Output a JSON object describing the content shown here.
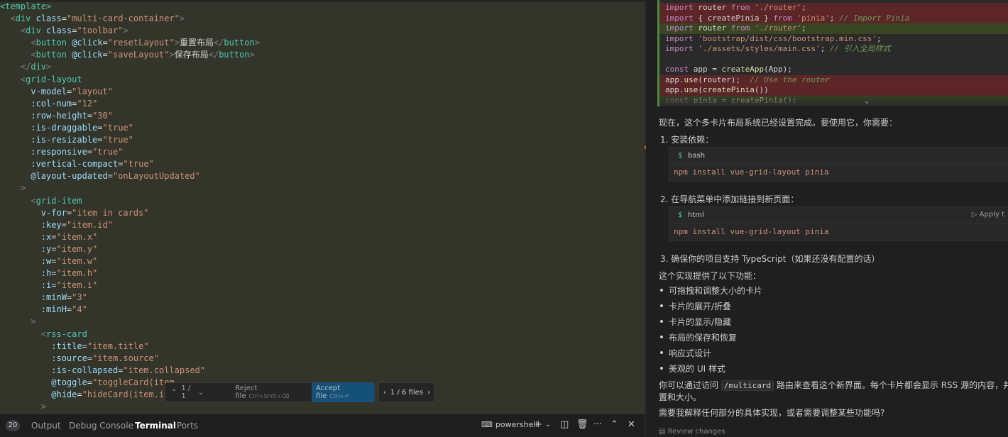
{
  "editor": {
    "lines": [
      [
        [
          "tag",
          "<template>"
        ]
      ],
      [
        [
          "tx",
          "  "
        ],
        [
          "br",
          "<"
        ],
        [
          "tag",
          "div"
        ],
        [
          "tx",
          " "
        ],
        [
          "at",
          "class"
        ],
        [
          "tx",
          "="
        ],
        [
          "st",
          "\"multi-card-container\""
        ],
        [
          "br",
          ">"
        ]
      ],
      [
        [
          "tx",
          "    "
        ],
        [
          "br",
          "<"
        ],
        [
          "tag",
          "div"
        ],
        [
          "tx",
          " "
        ],
        [
          "at",
          "class"
        ],
        [
          "tx",
          "="
        ],
        [
          "st",
          "\"toolbar\""
        ],
        [
          "br",
          ">"
        ]
      ],
      [
        [
          "tx",
          "      "
        ],
        [
          "br",
          "<"
        ],
        [
          "tag",
          "button"
        ],
        [
          "tx",
          " "
        ],
        [
          "at",
          "@click"
        ],
        [
          "tx",
          "="
        ],
        [
          "st",
          "\"resetLayout\""
        ],
        [
          "br",
          ">"
        ],
        [
          "tx",
          "重置布局"
        ],
        [
          "br",
          "</"
        ],
        [
          "tag",
          "button"
        ],
        [
          "br",
          ">"
        ]
      ],
      [
        [
          "tx",
          "      "
        ],
        [
          "br",
          "<"
        ],
        [
          "tag",
          "button"
        ],
        [
          "tx",
          " "
        ],
        [
          "at",
          "@click"
        ],
        [
          "tx",
          "="
        ],
        [
          "st",
          "\"saveLayout\""
        ],
        [
          "br",
          ">"
        ],
        [
          "tx",
          "保存布局"
        ],
        [
          "br",
          "</"
        ],
        [
          "tag",
          "button"
        ],
        [
          "br",
          ">"
        ]
      ],
      [
        [
          "tx",
          "    "
        ],
        [
          "br",
          "</"
        ],
        [
          "tag",
          "div"
        ],
        [
          "br",
          ">"
        ]
      ],
      [
        [
          "tx",
          "    "
        ],
        [
          "br",
          "<"
        ],
        [
          "tag",
          "grid-layout"
        ]
      ],
      [
        [
          "tx",
          "      "
        ],
        [
          "at",
          "v-model"
        ],
        [
          "tx",
          "="
        ],
        [
          "st",
          "\"layout\""
        ]
      ],
      [
        [
          "tx",
          "      "
        ],
        [
          "at",
          ":col-num"
        ],
        [
          "tx",
          "="
        ],
        [
          "st",
          "\"12\""
        ]
      ],
      [
        [
          "tx",
          "      "
        ],
        [
          "at",
          ":row-height"
        ],
        [
          "tx",
          "="
        ],
        [
          "st",
          "\"30\""
        ]
      ],
      [
        [
          "tx",
          "      "
        ],
        [
          "at",
          ":is-draggable"
        ],
        [
          "tx",
          "="
        ],
        [
          "st",
          "\"true\""
        ]
      ],
      [
        [
          "tx",
          "      "
        ],
        [
          "at",
          ":is-resizable"
        ],
        [
          "tx",
          "="
        ],
        [
          "st",
          "\"true\""
        ]
      ],
      [
        [
          "tx",
          "      "
        ],
        [
          "at",
          ":responsive"
        ],
        [
          "tx",
          "="
        ],
        [
          "st",
          "\"true\""
        ]
      ],
      [
        [
          "tx",
          "      "
        ],
        [
          "at",
          ":vertical-compact"
        ],
        [
          "tx",
          "="
        ],
        [
          "st",
          "\"true\""
        ]
      ],
      [
        [
          "tx",
          "      "
        ],
        [
          "at",
          "@layout-updated"
        ],
        [
          "tx",
          "="
        ],
        [
          "st",
          "\"onLayoutUpdated\""
        ]
      ],
      [
        [
          "tx",
          "    "
        ],
        [
          "br",
          ">"
        ]
      ],
      [
        [
          "tx",
          "      "
        ],
        [
          "br",
          "<"
        ],
        [
          "tag",
          "grid-item"
        ]
      ],
      [
        [
          "tx",
          "        "
        ],
        [
          "at",
          "v-for"
        ],
        [
          "tx",
          "="
        ],
        [
          "st",
          "\"item in cards\""
        ]
      ],
      [
        [
          "tx",
          "        "
        ],
        [
          "at",
          ":key"
        ],
        [
          "tx",
          "="
        ],
        [
          "st",
          "\"item.id\""
        ]
      ],
      [
        [
          "tx",
          "        "
        ],
        [
          "at",
          ":x"
        ],
        [
          "tx",
          "="
        ],
        [
          "st",
          "\"item.x\""
        ]
      ],
      [
        [
          "tx",
          "        "
        ],
        [
          "at",
          ":y"
        ],
        [
          "tx",
          "="
        ],
        [
          "st",
          "\"item.y\""
        ]
      ],
      [
        [
          "tx",
          "        "
        ],
        [
          "at",
          ":w"
        ],
        [
          "tx",
          "="
        ],
        [
          "st",
          "\"item.w\""
        ]
      ],
      [
        [
          "tx",
          "        "
        ],
        [
          "at",
          ":h"
        ],
        [
          "tx",
          "="
        ],
        [
          "st",
          "\"item.h\""
        ]
      ],
      [
        [
          "tx",
          "        "
        ],
        [
          "at",
          ":i"
        ],
        [
          "tx",
          "="
        ],
        [
          "st",
          "\"item.i\""
        ]
      ],
      [
        [
          "tx",
          "        "
        ],
        [
          "at",
          ":minW"
        ],
        [
          "tx",
          "="
        ],
        [
          "st",
          "\"3\""
        ]
      ],
      [
        [
          "tx",
          "        "
        ],
        [
          "at",
          ":minH"
        ],
        [
          "tx",
          "="
        ],
        [
          "st",
          "\"4\""
        ]
      ],
      [
        [
          "tx",
          "      "
        ],
        [
          "br",
          ">"
        ]
      ],
      [
        [
          "tx",
          "        "
        ],
        [
          "br",
          "<"
        ],
        [
          "tag",
          "rss-card"
        ]
      ],
      [
        [
          "tx",
          "          "
        ],
        [
          "at",
          ":title"
        ],
        [
          "tx",
          "="
        ],
        [
          "st",
          "\"item.title\""
        ]
      ],
      [
        [
          "tx",
          "          "
        ],
        [
          "at",
          ":source"
        ],
        [
          "tx",
          "="
        ],
        [
          "st",
          "\"item.source\""
        ]
      ],
      [
        [
          "tx",
          "          "
        ],
        [
          "at",
          ":is-collapsed"
        ],
        [
          "tx",
          "="
        ],
        [
          "st",
          "\"item.collapsed\""
        ]
      ],
      [
        [
          "tx",
          "          "
        ],
        [
          "at",
          "@toggle"
        ],
        [
          "tx",
          "="
        ],
        [
          "st",
          "\"toggleCard(item"
        ]
      ],
      [
        [
          "tx",
          "          "
        ],
        [
          "at",
          "@hide"
        ],
        [
          "tx",
          "="
        ],
        [
          "st",
          "\"hideCard(item.id)\""
        ]
      ],
      [
        [
          "tx",
          "        "
        ],
        [
          "br",
          ">"
        ]
      ]
    ]
  },
  "diffbar": {
    "nav_label": "1 / 1",
    "reject_label": "Reject file",
    "reject_key": "Ctrl+Shift+⌫",
    "accept_label": "Accept file",
    "accept_key": "Ctrl+⏎",
    "files_label": "1 / 6 files"
  },
  "panel": {
    "badge": "20",
    "tabs": [
      "Output",
      "Debug Console",
      "Terminal",
      "Ports"
    ],
    "active_tab": "Terminal",
    "shell": "powershell"
  },
  "chat": {
    "snippet": [
      {
        "kind": "del",
        "tokens": [
          [
            "kw",
            "import"
          ],
          [
            "tx",
            " router "
          ],
          [
            "kw",
            "from"
          ],
          [
            "tx",
            " "
          ],
          [
            "st",
            "'./router'"
          ],
          [
            "tx",
            ";"
          ]
        ]
      },
      {
        "kind": "del",
        "tokens": [
          [
            "kw",
            "import"
          ],
          [
            "tx",
            " { createPinia } "
          ],
          [
            "kw",
            "from"
          ],
          [
            "tx",
            " "
          ],
          [
            "st",
            "'pinia'"
          ],
          [
            "tx",
            "; "
          ],
          [
            "cm",
            "// Import Pinia"
          ]
        ]
      },
      {
        "kind": "add",
        "tokens": [
          [
            "kw",
            "import"
          ],
          [
            "tx",
            " router "
          ],
          [
            "kw",
            "from"
          ],
          [
            "tx",
            " "
          ],
          [
            "st",
            "'./router'"
          ],
          [
            "tx",
            ";"
          ]
        ]
      },
      {
        "kind": "none",
        "tokens": [
          [
            "kw",
            "import"
          ],
          [
            "tx",
            " "
          ],
          [
            "st",
            "'bootstrap/dist/css/bootstrap.min.css'"
          ],
          [
            "tx",
            ";"
          ]
        ]
      },
      {
        "kind": "none",
        "tokens": [
          [
            "kw",
            "import"
          ],
          [
            "tx",
            " "
          ],
          [
            "st",
            "'./assets/styles/main.css'"
          ],
          [
            "tx",
            "; "
          ],
          [
            "cm",
            "// 引入全局样式"
          ]
        ]
      },
      {
        "kind": "none",
        "tokens": []
      },
      {
        "kind": "none",
        "tokens": [
          [
            "kw",
            "const"
          ],
          [
            "tx",
            " app = "
          ],
          [
            "fn",
            "createApp"
          ],
          [
            "tx",
            "(App);"
          ]
        ]
      },
      {
        "kind": "del",
        "tokens": [
          [
            "tx",
            "app."
          ],
          [
            "fn",
            "use"
          ],
          [
            "tx",
            "(router);  "
          ],
          [
            "cm",
            "// Use the router"
          ]
        ]
      },
      {
        "kind": "del",
        "tokens": [
          [
            "tx",
            "app."
          ],
          [
            "fn",
            "use"
          ],
          [
            "tx",
            "("
          ],
          [
            "fn",
            "createPinia"
          ],
          [
            "tx",
            "())"
          ]
        ]
      },
      {
        "kind": "add",
        "tokens": [
          [
            "kw",
            "const"
          ],
          [
            "tx",
            " pinia = "
          ],
          [
            "fn",
            "createPinia"
          ],
          [
            "tx",
            "();"
          ]
        ]
      }
    ],
    "intro": "现在，这个多卡片布局系统已经设置完成。要使用它，你需要：",
    "step1": "1. 安装依赖：",
    "code1_lang": "bash",
    "code1_body": "npm install vue-grid-layout pinia",
    "step2": "2. 在导航菜单中添加链接到新页面：",
    "code2_lang": "html",
    "code2_apply": "Apply t",
    "code2_body": "npm install vue-grid-layout pinia",
    "step3": "3. 确保你的项目支持 TypeScript（如果还没有配置的话）",
    "features_title": "这个实现提供了以下功能：",
    "features": [
      "可拖拽和调整大小的卡片",
      "卡片的展开/折叠",
      "卡片的显示/隐藏",
      "布局的保存和恢复",
      "响应式设计",
      "美观的 UI 样式"
    ],
    "visit_pre": "你可以通过访问",
    "visit_code": "/multicard",
    "visit_post": "路由来查看这个新界面。每个卡片都会显示 RSS 源的内容，并且可",
    "visit_line2": "置和大小。",
    "closing": "需要我解释任何部分的具体实现，或者需要调整某些功能吗?",
    "review": "Review changes"
  }
}
